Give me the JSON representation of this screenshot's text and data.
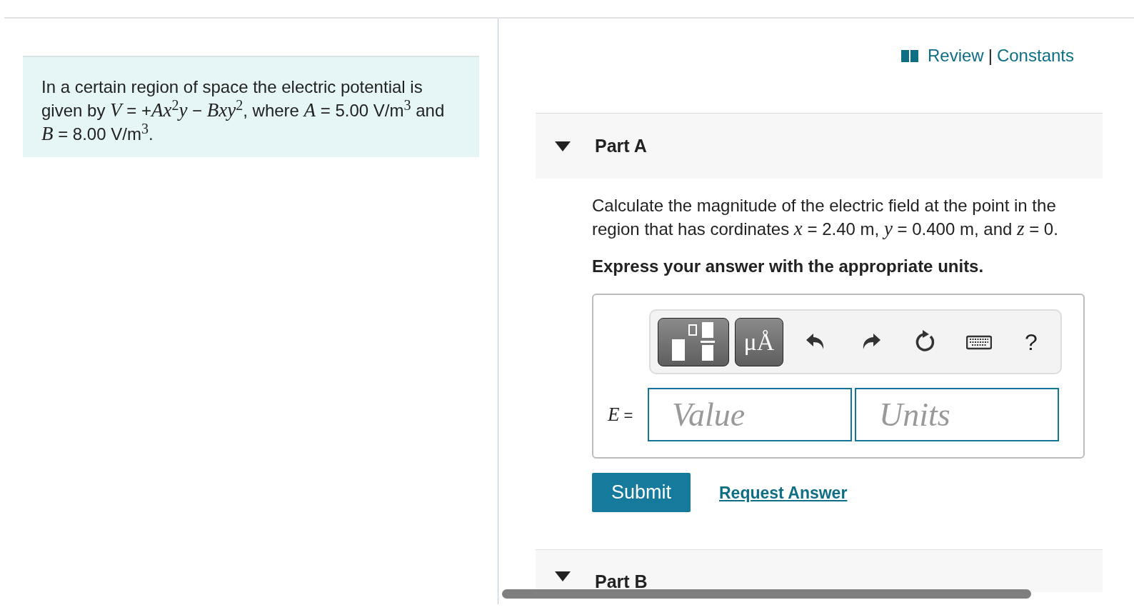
{
  "intro": {
    "text": "In a certain region of space the electric potential is given by *V* = +*Ax*$^{2}$*y* − *Bxy*$^{2}$, where *A* = 5.00 V/m$^{3}$ and *B* = 8.00 V/m$^{3}$."
  },
  "links": [
    {
      "label": "Review"
    },
    {
      "label": "Constants"
    }
  ],
  "link_separator": "|",
  "parts": [
    {
      "title": "Part A",
      "expanded": true,
      "question": "Calculate the magnitude of the electric field at the point in the region that has cordinates *x* = 2.40 m, *y* = 0.400 m, and *z* = 0.",
      "instruction": "Express your answer with the appropriate units.",
      "answer_label": "*E* =",
      "toolbar": [
        {
          "kind": "templates"
        },
        {
          "kind": "units",
          "label": "μÅ"
        },
        {
          "kind": "undo"
        },
        {
          "kind": "redo"
        },
        {
          "kind": "reset"
        },
        {
          "kind": "keyboard"
        },
        {
          "kind": "help",
          "label": "?"
        }
      ],
      "fields": [
        {
          "placeholder": "Value"
        },
        {
          "placeholder": "Units"
        }
      ],
      "buttons": [
        {
          "label": "Submit"
        }
      ],
      "request_link": "Request Answer"
    },
    {
      "title": "Part B",
      "expanded": true
    }
  ]
}
